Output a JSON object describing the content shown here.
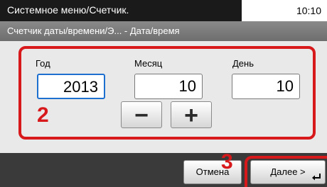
{
  "header": {
    "title": "Системное меню/Счетчик.",
    "time": "10:10",
    "breadcrumb": "Счетчик даты/времени/Э... - Дата/время"
  },
  "fields": {
    "year": {
      "label": "Год",
      "value": "2013"
    },
    "month": {
      "label": "Месяц",
      "value": "10"
    },
    "day": {
      "label": "День",
      "value": "10"
    }
  },
  "steppers": {
    "minus": "−",
    "plus": "+"
  },
  "annotations": {
    "area_number": "2",
    "next_number": "3"
  },
  "footer": {
    "cancel_label": "Отмена",
    "next_label": "Далее >"
  },
  "colors": {
    "annotation": "#d7191c",
    "active_border": "#1d6fd0"
  }
}
